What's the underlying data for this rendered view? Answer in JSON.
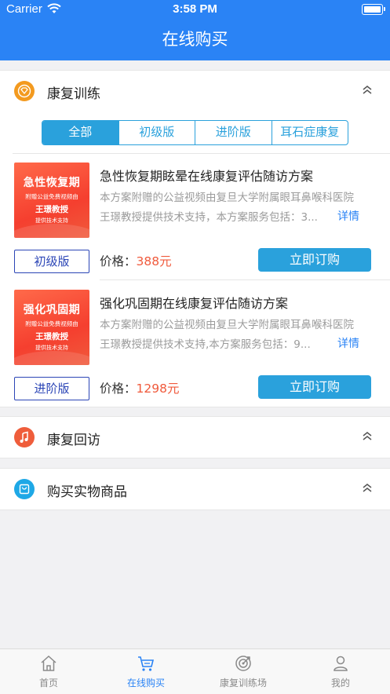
{
  "status_bar": {
    "carrier": "Carrier",
    "time": "3:58 PM"
  },
  "header": {
    "title": "在线购买"
  },
  "sections": {
    "training": {
      "title": "康复训练"
    },
    "followup": {
      "title": "康复回访"
    },
    "physical": {
      "title": "购买实物商品"
    }
  },
  "tabs": [
    "全部",
    "初级版",
    "进阶版",
    "耳石症康复"
  ],
  "products": [
    {
      "thumb": {
        "line1": "急性恢复期",
        "line2": "附赠公益免费视频由",
        "line3": "王璟教授",
        "line4": "提供技术支持"
      },
      "title": "急性恢复期眩晕在线康复评估随访方案",
      "desc_line1": "本方案附赠的公益视频由复旦大学附属眼耳鼻喉科医院",
      "desc_line2": "王璟教授提供技术支持，本方案服务包括：3...",
      "detail": "详情",
      "level": "初级版",
      "price_label": "价格：",
      "price": "388元",
      "buy": "立即订购"
    },
    {
      "thumb": {
        "line1": "强化巩固期",
        "line2": "附赠公益免费视频由",
        "line3": "王璟教授",
        "line4": "提供技术支持"
      },
      "title": "强化巩固期在线康复评估随访方案",
      "desc_line1": "本方案附赠的公益视频由复旦大学附属眼耳鼻喉科医院",
      "desc_line2": "王璟教授提供技术支持,本方案服务包括：9...",
      "detail": "详情",
      "level": "进阶版",
      "price_label": "价格：",
      "price": "1298元",
      "buy": "立即订购"
    }
  ],
  "tabbar": {
    "items": [
      {
        "label": "首页",
        "icon": "home-icon"
      },
      {
        "label": "在线购买",
        "icon": "cart-icon"
      },
      {
        "label": "康复训练场",
        "icon": "target-icon"
      },
      {
        "label": "我的",
        "icon": "user-icon"
      }
    ],
    "active_index": 1
  },
  "colors": {
    "primary": "#2a83f5",
    "accent": "#2aa1dc",
    "price": "#f05a3c",
    "level_border": "#2b45b6"
  }
}
